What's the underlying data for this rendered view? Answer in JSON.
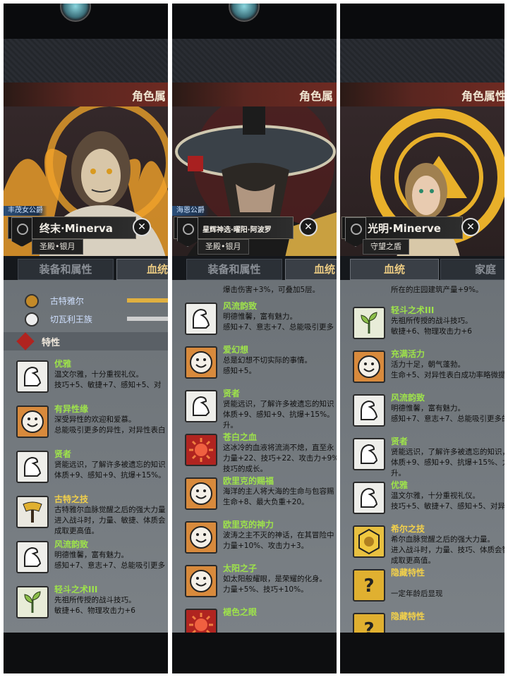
{
  "panels": [
    {
      "header_title": "角色属",
      "title_tag": "丰茂女公爵",
      "char_name": "终末·Minerva",
      "subtitle": "圣殿•银月",
      "tabs": [
        "装备和属性",
        "血统"
      ],
      "active_tab": 1,
      "lineage_items": [
        {
          "name": "古特雅尔"
        },
        {
          "name": "切瓦利王族"
        }
      ],
      "section_label": "特性",
      "traits": [
        {
          "icon": "arm-icon",
          "name": "优雅",
          "color": "green",
          "desc": "温文尔雅，十分重视礼仪。\n技巧+5、敏捷+7、感知+5、对"
        },
        {
          "icon": "smile-icon",
          "name": "有异性缘",
          "color": "green",
          "desc": "深受异性的欢迎和爱慕。\n总能吸引更多的异性，对异性表白"
        },
        {
          "icon": "arm-icon",
          "name": "贤者",
          "color": "green",
          "desc": "贤能远识，了解许多被遗忘的知识\n体质+9、感知+9、抗爆+15%。"
        },
        {
          "icon": "axe-icon",
          "name": "古特之技",
          "color": "yellow",
          "desc": "古特雅尔血脉觉醒之后的强大力量\n进入战斗时，力量、敏捷、体质会\n成取更高值。"
        },
        {
          "icon": "arm-icon",
          "name": "风流韵致",
          "color": "green",
          "desc": "明德惟馨，富有魅力。\n感知+7、意志+7、总能吸引更多"
        },
        {
          "icon": "sprout-icon",
          "name": "轻斗之术III",
          "color": "green",
          "desc": "先祖所传授的战斗技巧。\n敏捷+6、物理攻击力+6"
        }
      ]
    },
    {
      "header_title": "角色属",
      "title_tag": "海恩公爵",
      "char_name": "星辉神选·曜阳·阿波罗",
      "subtitle": "圣殿•银月",
      "tabs": [
        "装备和属性",
        "血统"
      ],
      "active_tab": 1,
      "top_snippet": "爆击伤害+3%，可叠加5层。",
      "traits": [
        {
          "icon": "arm-icon",
          "name": "风流韵致",
          "color": "green",
          "desc": "明德惟馨，富有魅力。\n感知+7、意志+7、总能吸引更多"
        },
        {
          "icon": "smile-icon",
          "name": "爱幻想",
          "color": "green",
          "desc": "总是幻想不切实际的事情。\n感知+5。"
        },
        {
          "icon": "arm-icon",
          "name": "贤者",
          "color": "green",
          "desc": "贤能远识，了解许多被遗忘的知识\n体质+9、感知+9、抗爆+15%。\n升。"
        },
        {
          "icon": "sun-icon",
          "name": "苍白之血",
          "color": "green",
          "desc": "这冰冷的血液将流淌不熄，直至永\n力量+22、技巧+22、攻击力+9%\n技巧的成长。"
        },
        {
          "icon": "smile-icon",
          "name": "欧里克的赐福",
          "color": "green",
          "desc": "海洋的主人将大海的生命与包容赐\n生命+8、最大负重+20。"
        },
        {
          "icon": "smile-icon",
          "name": "欧里克的神力",
          "color": "green",
          "desc": "波涛之主不灭的神话，在其冒险中\n力量+10%、攻击力+3。"
        },
        {
          "icon": "smile-icon",
          "name": "太阳之子",
          "color": "green",
          "desc": "如太阳般耀眼，是荣耀的化身。\n力量+5%、技巧+10%。"
        },
        {
          "icon": "sun-icon",
          "name": "褪色之眼",
          "color": "green",
          "desc": ""
        }
      ]
    },
    {
      "header_title": "角色属性",
      "char_name": "光明·Minerve",
      "subtitle": "守望之盾",
      "tabs": [
        "血统",
        "家庭"
      ],
      "active_tab": 0,
      "top_snippet": "所在的庄园建筑产量+9%。",
      "traits": [
        {
          "icon": "sprout-icon",
          "name": "轻斗之术III",
          "color": "green",
          "desc": "先祖所传授的战斗技巧。\n敏捷+6、物理攻击力+6"
        },
        {
          "icon": "smile-icon",
          "name": "充满活力",
          "color": "green",
          "desc": "活力十足，朝气蓬勃。\n生命+5、对异性表白成功率略微提"
        },
        {
          "icon": "arm-icon",
          "name": "风流韵致",
          "color": "green",
          "desc": "明德惟馨，富有魅力。\n感知+7、意志+7、总能吸引更多的"
        },
        {
          "icon": "arm-icon",
          "name": "贤者",
          "color": "green",
          "desc": "贤能远识，了解许多被遗忘的知识，\n体质+9、感知+9、抗爆+15%、力\n升。"
        },
        {
          "icon": "arm-icon",
          "name": "优雅",
          "color": "green",
          "desc": "温文尔雅，十分重视礼仪。\n技巧+5、敏捷+7、感知+5、对异"
        },
        {
          "icon": "gold-icon",
          "name": "希尔之技",
          "color": "yellow",
          "desc": "希尔血脉觉醒之后的强大力量。\n进入战斗时，力量、技巧、体质会智\n成取更高值。"
        },
        {
          "icon": "question-icon",
          "name": "隐藏特性",
          "color": "yellow",
          "desc": "\n一定年龄后显现"
        },
        {
          "icon": "question-icon",
          "name": "隐藏特性",
          "color": "yellow",
          "desc": ""
        }
      ]
    }
  ],
  "colors": {
    "green_name": "#9ee34a",
    "yellow_name": "#f2d04a",
    "active_tab": "#e9c982"
  }
}
